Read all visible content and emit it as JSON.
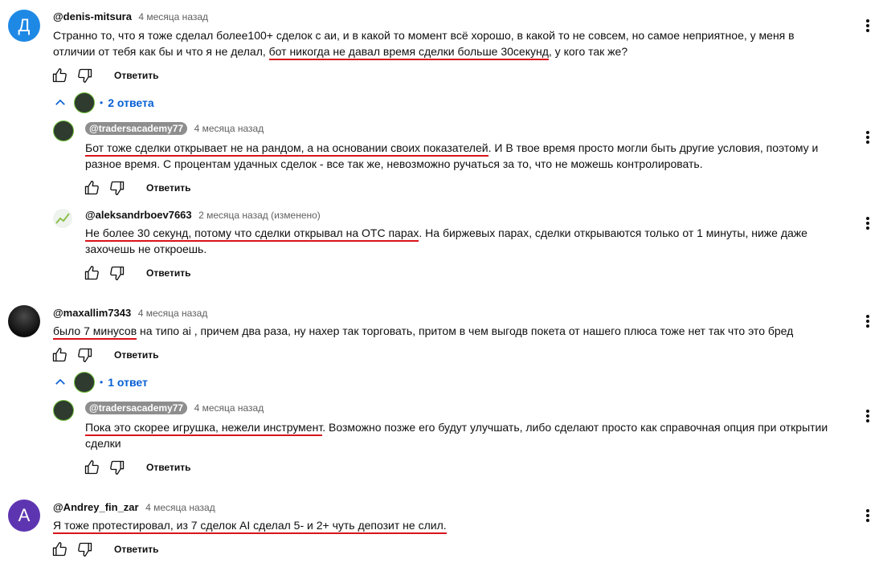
{
  "reply_label": "Ответить",
  "comments": [
    {
      "author": "@denis-mitsura",
      "time": "4 месяца назад",
      "avatar_letter": "Д",
      "avatar_color": "#1e88e5",
      "text_a": "Странно то, что я тоже сделал более100+ сделок  с аи, и в какой то момент всё хорошо, в какой то не совсем, но самое неприятное, у меня в отличии от тебя как бы и что я не делал, ",
      "text_hl": "бот никогда не давал время сделки больше 30секунд",
      "text_b": ", у кого так же?",
      "replies_toggle": "2 ответа",
      "replies": [
        {
          "author": "@tradersacademy77",
          "time": "4 месяца назад",
          "text_hl": "Бот тоже сделки открывает не на рандом, а на основании своих показателей",
          "text_b": ". И В твое время просто могли быть другие условия, поэтому и разное время. С процентам удачных сделок - все так же, невозможно ручаться за то, что не можешь контролировать."
        },
        {
          "author": "@aleksandrboev7663",
          "time": "2 месяца назад (изменено)",
          "text_hl": "Не более 30 секунд, потому что сделки открывал на OTC парах",
          "text_b": ". На биржевых парах, сделки открываются только от 1 минуты, ниже даже захочешь не откроешь."
        }
      ]
    },
    {
      "author": "@maxallim7343",
      "time": "4 месяца назад",
      "text_hl": "было 7 минусов",
      "text_b": " на типо ai , причем два раза, ну нахер так торговать, притом в чем выгодв покета от нашего плюса тоже нет так что это бред",
      "replies_toggle": "1 ответ",
      "replies": [
        {
          "author": "@tradersacademy77",
          "time": "4 месяца назад",
          "text_hl": "Пока это скорее игрушка, нежели инструмент",
          "text_b": ". Возможно позже его будут улучшать, либо сделают просто как справочная опция при открытии сделки"
        }
      ]
    },
    {
      "author": "@Andrey_fin_zar",
      "time": "4 месяца назад",
      "avatar_letter": "A",
      "avatar_color": "#5e35b1",
      "text_hl": "Я тоже протестировал, из 7 сделок AI сделал 5- и 2+ чуть депозит не слил.",
      "text_b": ""
    }
  ],
  "icons": [
    "thumb-up-icon",
    "thumb-down-icon",
    "more-vert-icon",
    "chevron-up-icon"
  ]
}
